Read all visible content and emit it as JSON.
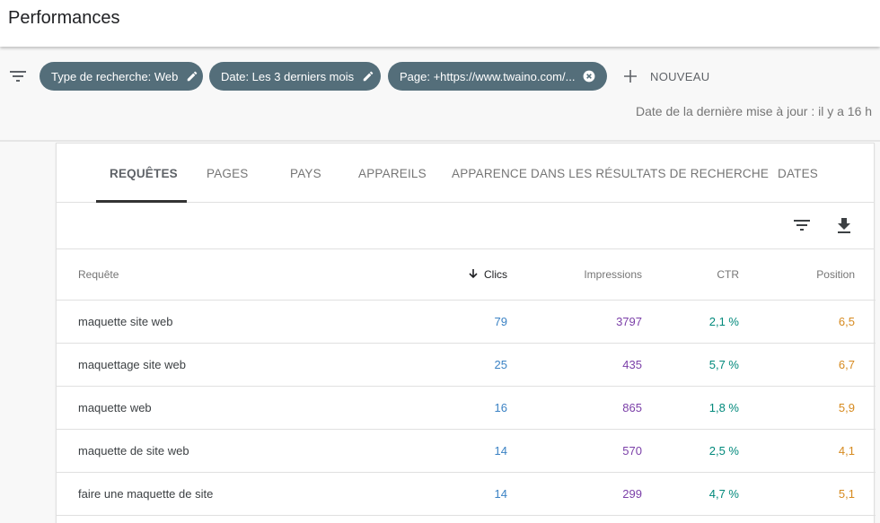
{
  "header": {
    "title": "Performances"
  },
  "filters": {
    "chips": [
      {
        "label": "Type de recherche: Web",
        "icon": "edit-icon"
      },
      {
        "label": "Date: Les 3 derniers mois",
        "icon": "edit-icon"
      },
      {
        "label": "Page: +https://www.twaino.com/...",
        "icon": "close-circle-icon"
      }
    ],
    "new_label": "NOUVEAU",
    "last_update": "Date de la dernière mise à jour : il y a 16 h"
  },
  "tabs": [
    {
      "label": "REQUÊTES",
      "active": true
    },
    {
      "label": "PAGES"
    },
    {
      "label": "PAYS"
    },
    {
      "label": "APPAREILS"
    },
    {
      "label": "APPARENCE DANS LES RÉSULTATS DE RECHERCHE"
    },
    {
      "label": "DATES"
    }
  ],
  "table": {
    "columns": [
      "Requête",
      "Clics",
      "Impressions",
      "CTR",
      "Position"
    ],
    "sorted_by": "Clics",
    "sort_direction": "descending",
    "rows": [
      {
        "query": "maquette site web",
        "clics": "79",
        "impressions": "3797",
        "ctr": "2,1 %",
        "position": "6,5"
      },
      {
        "query": "maquettage site web",
        "clics": "25",
        "impressions": "435",
        "ctr": "5,7 %",
        "position": "6,7"
      },
      {
        "query": "maquette web",
        "clics": "16",
        "impressions": "865",
        "ctr": "1,8 %",
        "position": "5,9"
      },
      {
        "query": "maquette de site web",
        "clics": "14",
        "impressions": "570",
        "ctr": "2,5 %",
        "position": "4,1"
      },
      {
        "query": "faire une maquette de site",
        "clics": "14",
        "impressions": "299",
        "ctr": "4,7 %",
        "position": "5,1"
      }
    ]
  },
  "colors": {
    "chip_bg": "#546e7a",
    "clics": "#3b82c4",
    "impressions": "#7b3fa8",
    "ctr": "#00897b",
    "position": "#d68a1f"
  }
}
